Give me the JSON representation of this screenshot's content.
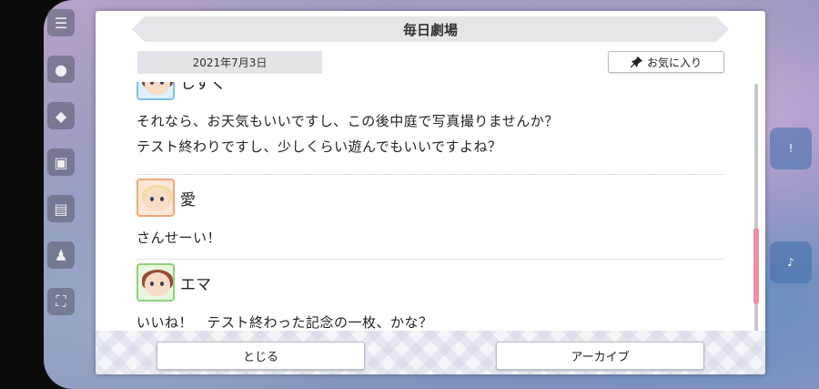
{
  "dialog": {
    "title": "毎日劇場",
    "date": "2021年7月3日",
    "favorite_label": "お気に入り",
    "close_label": "とじる",
    "archive_label": "アーカイブ"
  },
  "messages": [
    {
      "speaker": "しずく",
      "lines": [
        "それなら、お天気もいいですし、この後中庭で写真撮りませんか？",
        "テスト終わりですし、少しくらい遊んでもいいですよね？"
      ]
    },
    {
      "speaker": "愛",
      "lines": [
        "さんせーい！"
      ]
    },
    {
      "speaker": "エマ",
      "lines": [
        "いいね！　テスト終わった記念の一枚、かな？"
      ]
    }
  ],
  "icons": {
    "favorite": "pin-icon",
    "menu": "hamburger-menu-icon"
  },
  "colors": {
    "scroll_thumb": "#f08fa4",
    "avatar_shizuku_border": "#7fc0e8",
    "avatar_ai_border": "#f2a67a",
    "avatar_emma_border": "#8fd07a"
  }
}
